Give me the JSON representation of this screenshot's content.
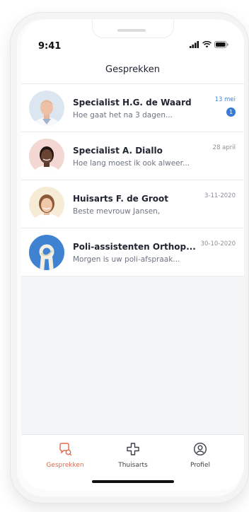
{
  "status": {
    "time": "9:41"
  },
  "header": {
    "title": "Gesprekken"
  },
  "conversations": [
    {
      "name": "Specialist H.G. de Waard",
      "preview": "Hoe gaat het na 3 dagen...",
      "date": "13 mei",
      "unread": "1"
    },
    {
      "name": "Specialist A. Diallo",
      "preview": "Hoe lang moest ik ook alweer...",
      "date": "28 april"
    },
    {
      "name": "Huisarts F. de Groot",
      "preview": "Beste mevrouw Jansen,",
      "date": "3-11-2020"
    },
    {
      "name": "Poli-assistenten Orthop...",
      "preview": "Morgen is uw poli-afspraak...",
      "date": "30-10-2020"
    }
  ],
  "tabs": [
    {
      "label": "Gesprekken",
      "icon": "chat-icon",
      "active": true
    },
    {
      "label": "Thuisarts",
      "icon": "medical-cross-icon",
      "active": false
    },
    {
      "label": "Profiel",
      "icon": "profile-icon",
      "active": false
    }
  ],
  "colors": {
    "accent": "#e46a4e",
    "unread": "#3a7bd5"
  }
}
